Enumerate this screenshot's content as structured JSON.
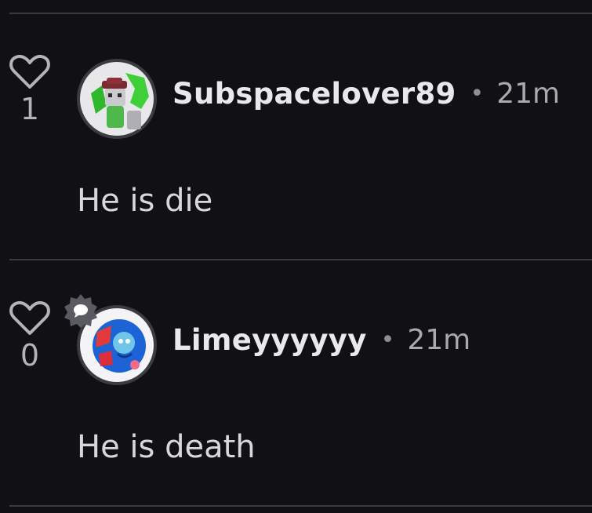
{
  "comments": [
    {
      "username": "Subspacelover89",
      "separator": "•",
      "timestamp": "21m",
      "text": "He is die",
      "like_count": "1",
      "avatar_icon": "avatar-green-character",
      "has_badge": false
    },
    {
      "username": "Limeyyyyyy",
      "separator": "•",
      "timestamp": "21m",
      "text": "He is death",
      "like_count": "0",
      "avatar_icon": "avatar-blue-character",
      "has_badge": true,
      "badge_icon": "chat-bubble-badge-icon"
    }
  ],
  "colors": {
    "background": "#111115",
    "divider": "#3a3a40",
    "username": "#e9e9ec",
    "timestamp": "#a9a9af",
    "body_text": "#d8d8dc",
    "like_count": "#b3b3b8"
  }
}
